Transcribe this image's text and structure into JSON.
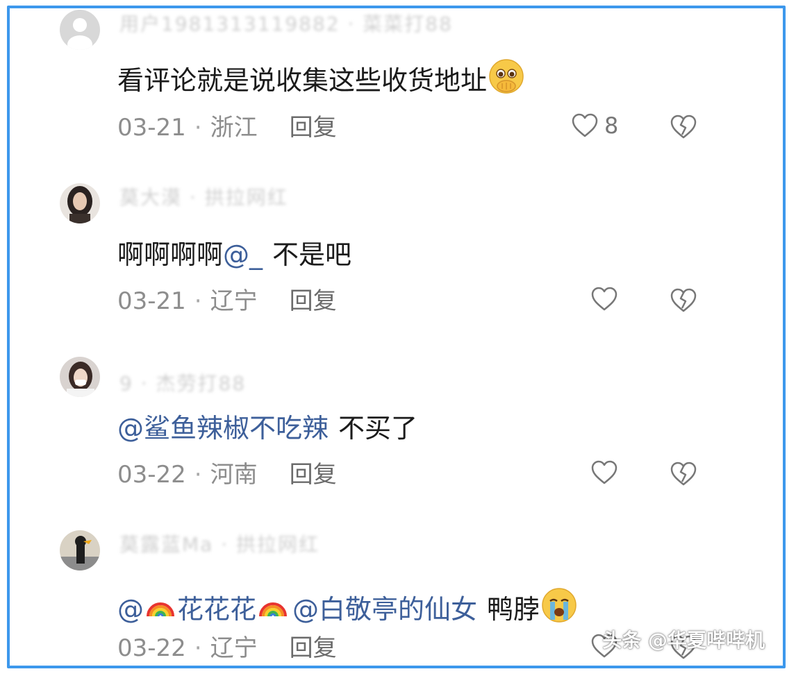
{
  "comments": [
    {
      "username": "用户1981313119882 · 菜菜打88",
      "text_plain": "看评论就是说收集这些收货地址",
      "emoji": "pleading-hands-emoji",
      "date": "03-21",
      "location": "浙江",
      "reply": "回复",
      "likes": "8"
    },
    {
      "username": "莫大漠 · 拱拉网红",
      "text_plain": "啊啊啊啊",
      "mention": "@_",
      "text_after": "不是吧",
      "date": "03-21",
      "location": "辽宁",
      "reply": "回复",
      "likes": ""
    },
    {
      "username": "9 · 杰劳打88",
      "mention": "@鲨鱼辣椒不吃辣",
      "text_after": "不买了",
      "date": "03-22",
      "location": "河南",
      "reply": "回复",
      "likes": ""
    },
    {
      "username": "莫露蓝Ma · 拱拉网红",
      "mention_prefix": "@",
      "mention_name": "花花花",
      "mention2": "@白敬亭的仙女",
      "text_after": "鸭脖",
      "emoji": "crying-emoji",
      "date": "03-22",
      "location": "辽宁",
      "reply": "回复",
      "likes": ""
    }
  ],
  "icons": {
    "like": "heart-outline-icon",
    "dislike": "broken-heart-icon",
    "rainbow": "rainbow-emoji"
  },
  "colors": {
    "frame_border": "#3d98ec",
    "mention": "#3d5f9a",
    "meta": "#8d8d8d"
  },
  "watermark": "头条 @华夏哔哔机"
}
